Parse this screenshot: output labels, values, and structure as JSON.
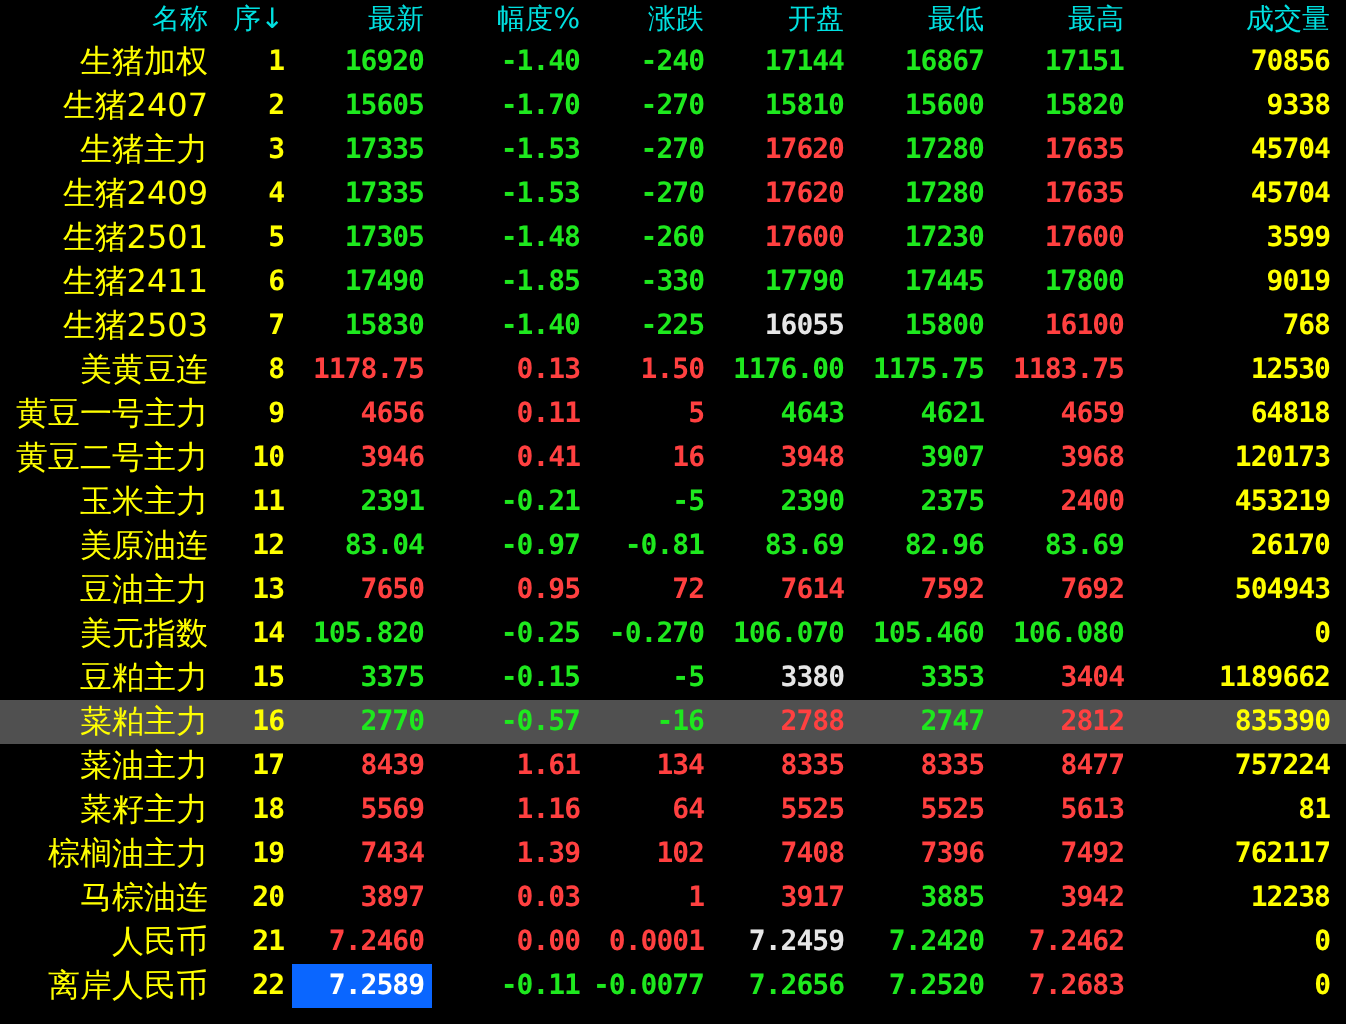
{
  "columns": [
    "名称",
    "序↓",
    "最新",
    "幅度%",
    "涨跌",
    "开盘",
    "最低",
    "最高",
    "成交量"
  ],
  "rows": [
    {
      "name": "生猪加权",
      "seq": "1",
      "cells": [
        {
          "text": "16920",
          "color": "#1ee81e"
        },
        {
          "text": "-1.40",
          "color": "#1ee81e"
        },
        {
          "text": "-240",
          "color": "#1ee81e"
        },
        {
          "text": "17144",
          "color": "#1ee81e"
        },
        {
          "text": "16867",
          "color": "#1ee81e"
        },
        {
          "text": "17151",
          "color": "#1ee81e"
        }
      ],
      "volume": "70856",
      "selected": false,
      "cursor": false
    },
    {
      "name": "生猪2407",
      "seq": "2",
      "cells": [
        {
          "text": "15605",
          "color": "#1ee81e"
        },
        {
          "text": "-1.70",
          "color": "#1ee81e"
        },
        {
          "text": "-270",
          "color": "#1ee81e"
        },
        {
          "text": "15810",
          "color": "#1ee81e"
        },
        {
          "text": "15600",
          "color": "#1ee81e"
        },
        {
          "text": "15820",
          "color": "#1ee81e"
        }
      ],
      "volume": "9338",
      "selected": false,
      "cursor": false
    },
    {
      "name": "生猪主力",
      "seq": "3",
      "cells": [
        {
          "text": "17335",
          "color": "#1ee81e"
        },
        {
          "text": "-1.53",
          "color": "#1ee81e"
        },
        {
          "text": "-270",
          "color": "#1ee81e"
        },
        {
          "text": "17620",
          "color": "#ff4040"
        },
        {
          "text": "17280",
          "color": "#1ee81e"
        },
        {
          "text": "17635",
          "color": "#ff4040"
        }
      ],
      "volume": "45704",
      "selected": false,
      "cursor": false
    },
    {
      "name": "生猪2409",
      "seq": "4",
      "cells": [
        {
          "text": "17335",
          "color": "#1ee81e"
        },
        {
          "text": "-1.53",
          "color": "#1ee81e"
        },
        {
          "text": "-270",
          "color": "#1ee81e"
        },
        {
          "text": "17620",
          "color": "#ff4040"
        },
        {
          "text": "17280",
          "color": "#1ee81e"
        },
        {
          "text": "17635",
          "color": "#ff4040"
        }
      ],
      "volume": "45704",
      "selected": false,
      "cursor": false
    },
    {
      "name": "生猪2501",
      "seq": "5",
      "cells": [
        {
          "text": "17305",
          "color": "#1ee81e"
        },
        {
          "text": "-1.48",
          "color": "#1ee81e"
        },
        {
          "text": "-260",
          "color": "#1ee81e"
        },
        {
          "text": "17600",
          "color": "#ff4040"
        },
        {
          "text": "17230",
          "color": "#1ee81e"
        },
        {
          "text": "17600",
          "color": "#ff4040"
        }
      ],
      "volume": "3599",
      "selected": false,
      "cursor": false
    },
    {
      "name": "生猪2411",
      "seq": "6",
      "cells": [
        {
          "text": "17490",
          "color": "#1ee81e"
        },
        {
          "text": "-1.85",
          "color": "#1ee81e"
        },
        {
          "text": "-330",
          "color": "#1ee81e"
        },
        {
          "text": "17790",
          "color": "#1ee81e"
        },
        {
          "text": "17445",
          "color": "#1ee81e"
        },
        {
          "text": "17800",
          "color": "#1ee81e"
        }
      ],
      "volume": "9019",
      "selected": false,
      "cursor": false
    },
    {
      "name": "生猪2503",
      "seq": "7",
      "cells": [
        {
          "text": "15830",
          "color": "#1ee81e"
        },
        {
          "text": "-1.40",
          "color": "#1ee81e"
        },
        {
          "text": "-225",
          "color": "#1ee81e"
        },
        {
          "text": "16055",
          "color": "#e6e6e6"
        },
        {
          "text": "15800",
          "color": "#1ee81e"
        },
        {
          "text": "16100",
          "color": "#ff4040"
        }
      ],
      "volume": "768",
      "selected": false,
      "cursor": false
    },
    {
      "name": "美黄豆连",
      "seq": "8",
      "cells": [
        {
          "text": "1178.75",
          "color": "#ff4040"
        },
        {
          "text": "0.13",
          "color": "#ff4040"
        },
        {
          "text": "1.50",
          "color": "#ff4040"
        },
        {
          "text": "1176.00",
          "color": "#1ee81e"
        },
        {
          "text": "1175.75",
          "color": "#1ee81e"
        },
        {
          "text": "1183.75",
          "color": "#ff4040"
        }
      ],
      "volume": "12530",
      "selected": false,
      "cursor": false
    },
    {
      "name": "黄豆一号主力",
      "seq": "9",
      "cells": [
        {
          "text": "4656",
          "color": "#ff4040"
        },
        {
          "text": "0.11",
          "color": "#ff4040"
        },
        {
          "text": "5",
          "color": "#ff4040"
        },
        {
          "text": "4643",
          "color": "#1ee81e"
        },
        {
          "text": "4621",
          "color": "#1ee81e"
        },
        {
          "text": "4659",
          "color": "#ff4040"
        }
      ],
      "volume": "64818",
      "selected": false,
      "cursor": false
    },
    {
      "name": "黄豆二号主力",
      "seq": "10",
      "cells": [
        {
          "text": "3946",
          "color": "#ff4040"
        },
        {
          "text": "0.41",
          "color": "#ff4040"
        },
        {
          "text": "16",
          "color": "#ff4040"
        },
        {
          "text": "3948",
          "color": "#ff4040"
        },
        {
          "text": "3907",
          "color": "#1ee81e"
        },
        {
          "text": "3968",
          "color": "#ff4040"
        }
      ],
      "volume": "120173",
      "selected": false,
      "cursor": false
    },
    {
      "name": "玉米主力",
      "seq": "11",
      "cells": [
        {
          "text": "2391",
          "color": "#1ee81e"
        },
        {
          "text": "-0.21",
          "color": "#1ee81e"
        },
        {
          "text": "-5",
          "color": "#1ee81e"
        },
        {
          "text": "2390",
          "color": "#1ee81e"
        },
        {
          "text": "2375",
          "color": "#1ee81e"
        },
        {
          "text": "2400",
          "color": "#ff4040"
        }
      ],
      "volume": "453219",
      "selected": false,
      "cursor": false
    },
    {
      "name": "美原油连",
      "seq": "12",
      "cells": [
        {
          "text": "83.04",
          "color": "#1ee81e"
        },
        {
          "text": "-0.97",
          "color": "#1ee81e"
        },
        {
          "text": "-0.81",
          "color": "#1ee81e"
        },
        {
          "text": "83.69",
          "color": "#1ee81e"
        },
        {
          "text": "82.96",
          "color": "#1ee81e"
        },
        {
          "text": "83.69",
          "color": "#1ee81e"
        }
      ],
      "volume": "26170",
      "selected": false,
      "cursor": false
    },
    {
      "name": "豆油主力",
      "seq": "13",
      "cells": [
        {
          "text": "7650",
          "color": "#ff4040"
        },
        {
          "text": "0.95",
          "color": "#ff4040"
        },
        {
          "text": "72",
          "color": "#ff4040"
        },
        {
          "text": "7614",
          "color": "#ff4040"
        },
        {
          "text": "7592",
          "color": "#ff4040"
        },
        {
          "text": "7692",
          "color": "#ff4040"
        }
      ],
      "volume": "504943",
      "selected": false,
      "cursor": false
    },
    {
      "name": "美元指数",
      "seq": "14",
      "cells": [
        {
          "text": "105.820",
          "color": "#1ee81e"
        },
        {
          "text": "-0.25",
          "color": "#1ee81e"
        },
        {
          "text": "-0.270",
          "color": "#1ee81e"
        },
        {
          "text": "106.070",
          "color": "#1ee81e"
        },
        {
          "text": "105.460",
          "color": "#1ee81e"
        },
        {
          "text": "106.080",
          "color": "#1ee81e"
        }
      ],
      "volume": "0",
      "selected": false,
      "cursor": false
    },
    {
      "name": "豆粕主力",
      "seq": "15",
      "cells": [
        {
          "text": "3375",
          "color": "#1ee81e"
        },
        {
          "text": "-0.15",
          "color": "#1ee81e"
        },
        {
          "text": "-5",
          "color": "#1ee81e"
        },
        {
          "text": "3380",
          "color": "#e6e6e6"
        },
        {
          "text": "3353",
          "color": "#1ee81e"
        },
        {
          "text": "3404",
          "color": "#ff4040"
        }
      ],
      "volume": "1189662",
      "selected": false,
      "cursor": false
    },
    {
      "name": "菜粕主力",
      "seq": "16",
      "cells": [
        {
          "text": "2770",
          "color": "#1ee81e"
        },
        {
          "text": "-0.57",
          "color": "#1ee81e"
        },
        {
          "text": "-16",
          "color": "#1ee81e"
        },
        {
          "text": "2788",
          "color": "#ff4040"
        },
        {
          "text": "2747",
          "color": "#1ee81e"
        },
        {
          "text": "2812",
          "color": "#ff4040"
        }
      ],
      "volume": "835390",
      "selected": true,
      "cursor": false
    },
    {
      "name": "菜油主力",
      "seq": "17",
      "cells": [
        {
          "text": "8439",
          "color": "#ff4040"
        },
        {
          "text": "1.61",
          "color": "#ff4040"
        },
        {
          "text": "134",
          "color": "#ff4040"
        },
        {
          "text": "8335",
          "color": "#ff4040"
        },
        {
          "text": "8335",
          "color": "#ff4040"
        },
        {
          "text": "8477",
          "color": "#ff4040"
        }
      ],
      "volume": "757224",
      "selected": false,
      "cursor": false
    },
    {
      "name": "菜籽主力",
      "seq": "18",
      "cells": [
        {
          "text": "5569",
          "color": "#ff4040"
        },
        {
          "text": "1.16",
          "color": "#ff4040"
        },
        {
          "text": "64",
          "color": "#ff4040"
        },
        {
          "text": "5525",
          "color": "#ff4040"
        },
        {
          "text": "5525",
          "color": "#ff4040"
        },
        {
          "text": "5613",
          "color": "#ff4040"
        }
      ],
      "volume": "81",
      "selected": false,
      "cursor": false
    },
    {
      "name": "棕榈油主力",
      "seq": "19",
      "cells": [
        {
          "text": "7434",
          "color": "#ff4040"
        },
        {
          "text": "1.39",
          "color": "#ff4040"
        },
        {
          "text": "102",
          "color": "#ff4040"
        },
        {
          "text": "7408",
          "color": "#ff4040"
        },
        {
          "text": "7396",
          "color": "#ff4040"
        },
        {
          "text": "7492",
          "color": "#ff4040"
        }
      ],
      "volume": "762117",
      "selected": false,
      "cursor": false
    },
    {
      "name": "马棕油连",
      "seq": "20",
      "cells": [
        {
          "text": "3897",
          "color": "#ff4040"
        },
        {
          "text": "0.03",
          "color": "#ff4040"
        },
        {
          "text": "1",
          "color": "#ff4040"
        },
        {
          "text": "3917",
          "color": "#ff4040"
        },
        {
          "text": "3885",
          "color": "#1ee81e"
        },
        {
          "text": "3942",
          "color": "#ff4040"
        }
      ],
      "volume": "12238",
      "selected": false,
      "cursor": false
    },
    {
      "name": "人民币",
      "seq": "21",
      "cells": [
        {
          "text": "7.2460",
          "color": "#ff4040"
        },
        {
          "text": "0.00",
          "color": "#ff4040"
        },
        {
          "text": "0.0001",
          "color": "#ff4040"
        },
        {
          "text": "7.2459",
          "color": "#e6e6e6"
        },
        {
          "text": "7.2420",
          "color": "#1ee81e"
        },
        {
          "text": "7.2462",
          "color": "#ff4040"
        }
      ],
      "volume": "0",
      "selected": false,
      "cursor": false
    },
    {
      "name": "离岸人民币",
      "seq": "22",
      "cells": [
        {
          "text": "7.2589",
          "color": "#ffffff"
        },
        {
          "text": "-0.11",
          "color": "#1ee81e"
        },
        {
          "text": "-0.0077",
          "color": "#1ee81e"
        },
        {
          "text": "7.2656",
          "color": "#1ee81e"
        },
        {
          "text": "7.2520",
          "color": "#1ee81e"
        },
        {
          "text": "7.2683",
          "color": "#ff4040"
        }
      ],
      "volume": "0",
      "selected": false,
      "cursor": true
    }
  ]
}
